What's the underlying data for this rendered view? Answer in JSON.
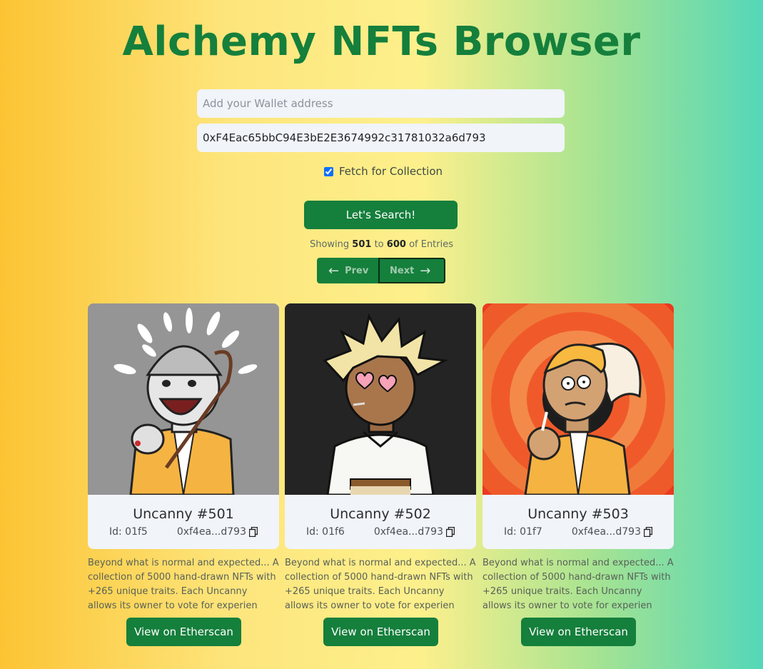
{
  "title": "Alchemy NFTs Browser",
  "wallet_input": {
    "placeholder": "Add your Wallet address",
    "value": ""
  },
  "collection_input": {
    "value": "0xF4Eac65bbC94E3bE2E3674992c31781032a6d793"
  },
  "fetch_collection": {
    "label": "Fetch for Collection",
    "checked": true
  },
  "search_button": "Let's Search!",
  "showing": {
    "prefix": "Showing",
    "from": "501",
    "to_word": "to",
    "to": "600",
    "suffix": "of Entries"
  },
  "pagination": {
    "prev": "Prev",
    "next": "Next"
  },
  "cards": [
    {
      "name": "Uncanny #501",
      "id": "Id: 01f5",
      "address": "0xf4ea...d793",
      "description": "Beyond what is normal and expected... A collection of 5000 hand-drawn NFTs with +265 unique traits. Each Uncanny allows its owner to vote for experien",
      "button": "View on Etherscan"
    },
    {
      "name": "Uncanny #502",
      "id": "Id: 01f6",
      "address": "0xf4ea...d793",
      "description": "Beyond what is normal and expected... A collection of 5000 hand-drawn NFTs with +265 unique traits. Each Uncanny allows its owner to vote for experien",
      "button": "View on Etherscan"
    },
    {
      "name": "Uncanny #503",
      "id": "Id: 01f7",
      "address": "0xf4ea...d793",
      "description": "Beyond what is normal and expected... A collection of 5000 hand-drawn NFTs with +265 unique traits. Each Uncanny allows its owner to vote for experien",
      "button": "View on Etherscan"
    }
  ],
  "colors": {
    "accent": "#157f3c",
    "title": "#157f3c",
    "card_body": "#f1f4f9"
  }
}
